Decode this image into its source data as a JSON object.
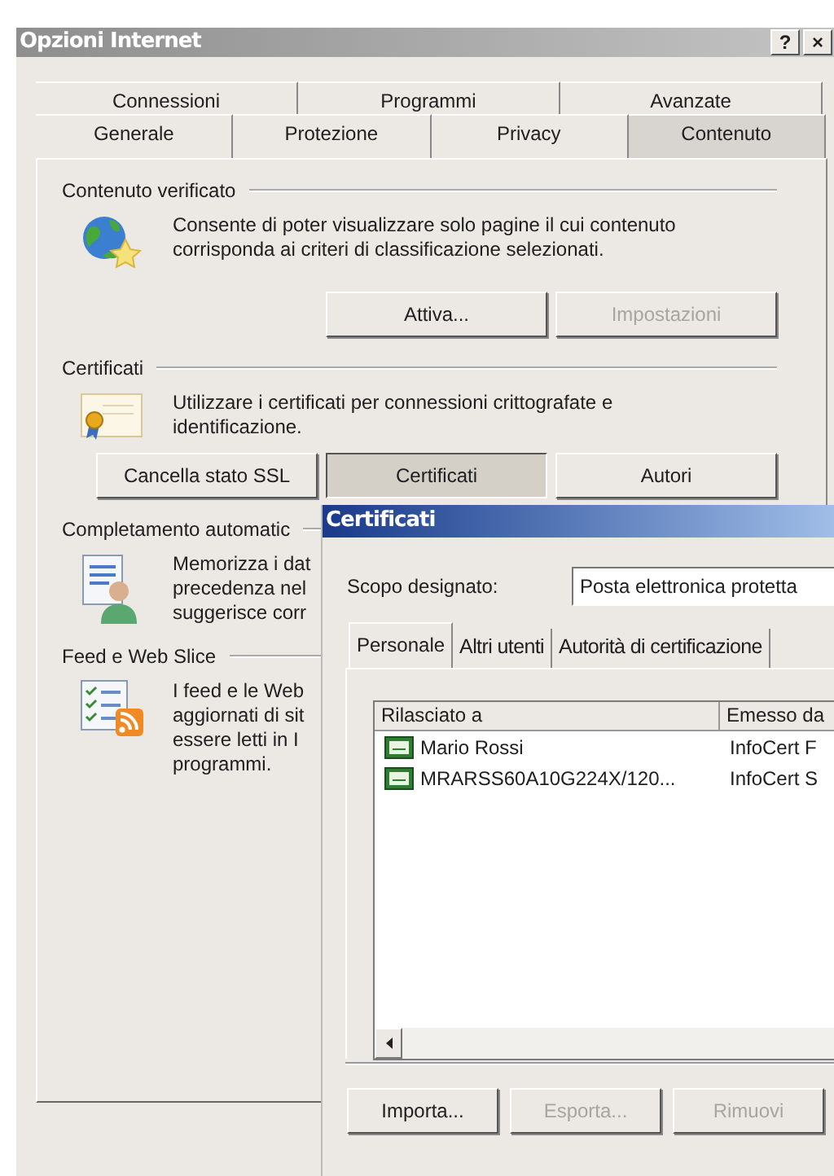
{
  "window": {
    "title": "Opzioni Internet",
    "controls": [
      "?",
      "×"
    ]
  },
  "tab_rows": [
    [
      {
        "label": "Connessioni",
        "selected": false
      },
      {
        "label": "Programmi",
        "selected": false
      },
      {
        "label": "Avanzate",
        "selected": false
      }
    ],
    [
      {
        "label": "Generale",
        "selected": false
      },
      {
        "label": "Protezione",
        "selected": false
      },
      {
        "label": "Privacy",
        "selected": false
      },
      {
        "label": "Contenuto",
        "selected": true
      }
    ]
  ],
  "sections": [
    {
      "kind": "ratings",
      "title": "Contenuto verificato",
      "lines": [
        "Consente di poter visualizzare solo pagine il cui contenuto",
        "corrisponda ai criteri di classificazione selezionati."
      ],
      "buttons": [
        {
          "label": "Attiva...",
          "disabled": false,
          "pressed": false
        },
        {
          "label": "Impostazioni",
          "disabled": true,
          "pressed": false
        }
      ]
    },
    {
      "kind": "certificates",
      "title": "Certificati",
      "lines": [
        "Utilizzare i certificati per connessioni crittografate e",
        "identificazione."
      ],
      "buttons": [
        {
          "label": "Cancella stato SSL",
          "disabled": false,
          "pressed": false
        },
        {
          "label": "Certificati",
          "disabled": false,
          "pressed": true
        },
        {
          "label": "Autori",
          "disabled": false,
          "pressed": false
        }
      ]
    },
    {
      "kind": "autocomplete",
      "title": "Completamento automatic",
      "lines": [
        "Memorizza i dat",
        "precedenza nel",
        "suggerisce corr"
      ]
    },
    {
      "kind": "feeds",
      "title": "Feed e Web Slice",
      "lines": [
        "I feed e le Web",
        "aggiornati di sit",
        "essere letti in I",
        "programmi."
      ]
    }
  ],
  "dialog": {
    "title": "Certificati",
    "purpose_label": "Scopo designato:",
    "purpose_value": "Posta elettronica protetta",
    "tabs": [
      {
        "label": "Personale",
        "selected": true
      },
      {
        "label": "Altri utenti",
        "selected": false
      },
      {
        "label": "Autorità di certificazione",
        "selected": false
      }
    ],
    "columns": [
      "Rilasciato a",
      "Emesso da"
    ],
    "rows": [
      {
        "cells": [
          "Mario Rossi",
          "InfoCert F"
        ]
      },
      {
        "cells": [
          "MRARSS60A10G224X/120...",
          "InfoCert S"
        ]
      }
    ],
    "buttons": [
      {
        "label": "Importa...",
        "disabled": false
      },
      {
        "label": "Esporta...",
        "disabled": true
      },
      {
        "label": "Rimuovi",
        "disabled": true
      }
    ]
  }
}
